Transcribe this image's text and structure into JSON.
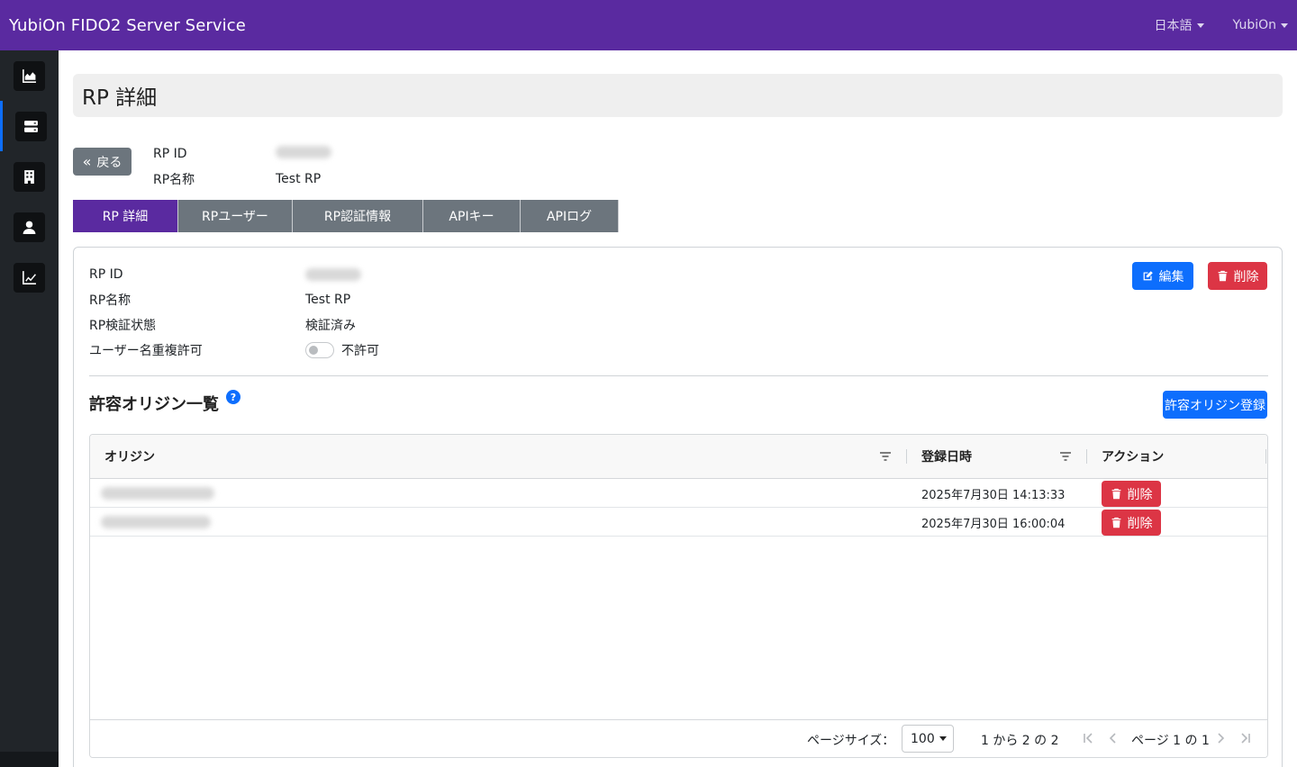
{
  "app": {
    "title": "YubiOn FIDO2 Server Service"
  },
  "topnav": {
    "language": "日本語",
    "user": "YubiOn"
  },
  "sidebar": {
    "items": [
      {
        "icon": "chart-area-icon",
        "active": false
      },
      {
        "icon": "server-icon",
        "active": true
      },
      {
        "icon": "building-icon",
        "active": false
      },
      {
        "icon": "user-icon",
        "active": false
      },
      {
        "icon": "chart-line-icon",
        "active": false
      }
    ]
  },
  "page": {
    "title": "RP 詳細"
  },
  "back": {
    "label": "戻る"
  },
  "summary": {
    "rp_id_label": "RP ID",
    "rp_id_value": "",
    "rp_name_label": "RP名称",
    "rp_name_value": "Test RP"
  },
  "tabs": [
    "RP 詳細",
    "RPユーザー",
    "RP認証情報",
    "APIキー",
    "APIログ"
  ],
  "detail": {
    "rp_id_label": "RP ID",
    "rp_id_value": "",
    "rp_name_label": "RP名称",
    "rp_name_value": "Test RP",
    "verify_label": "RP検証状態",
    "verify_value": "検証済み",
    "dup_label": "ユーザー名重複許可",
    "dup_value": "不許可",
    "dup_enabled": false
  },
  "actions": {
    "edit_label": "編集",
    "delete_label": "削除"
  },
  "origins": {
    "title": "許容オリジン一覧",
    "help": "?",
    "register_label": "許容オリジン登録",
    "columns": {
      "origin": "オリジン",
      "date": "登録日時",
      "action": "アクション"
    },
    "rows": [
      {
        "origin": "",
        "date": "2025年7月30日 14:13:33",
        "delete_label": "削除"
      },
      {
        "origin": "",
        "date": "2025年7月30日 16:00:04",
        "delete_label": "削除"
      }
    ],
    "pager": {
      "size_label": "ページサイズ：",
      "size_value": "100",
      "range": "1 から 2 の 2",
      "page": "ページ 1 の 1"
    }
  },
  "colors": {
    "brand": "#5a2aa0",
    "primary": "#0d6efd",
    "danger": "#dc3545",
    "secondary": "#6c757d",
    "sidebar": "#212529"
  }
}
